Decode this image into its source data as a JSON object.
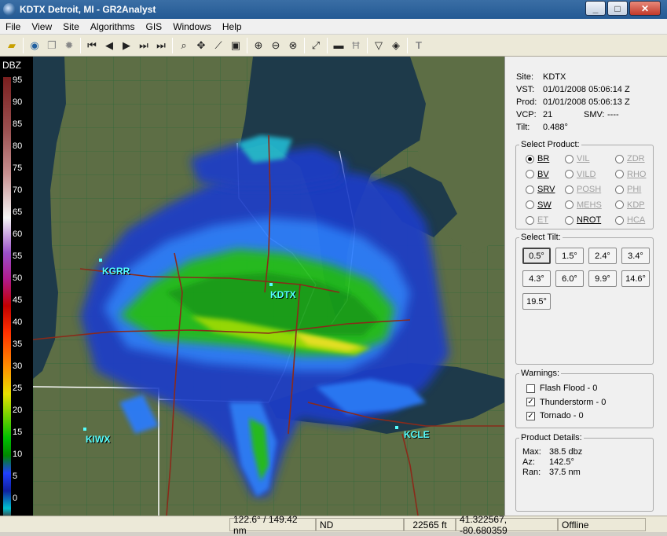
{
  "window": {
    "title": "KDTX Detroit, MI - GR2Analyst"
  },
  "menu": [
    "File",
    "View",
    "Site",
    "Algorithms",
    "GIS",
    "Windows",
    "Help"
  ],
  "scale": {
    "unit": "DBZ",
    "ticks": [
      "95",
      "90",
      "85",
      "80",
      "75",
      "70",
      "65",
      "60",
      "55",
      "50",
      "45",
      "40",
      "35",
      "30",
      "25",
      "20",
      "15",
      "10",
      "5",
      "0"
    ]
  },
  "map": {
    "site_labels": [
      "KGRR",
      "KDTX",
      "KIWX",
      "KCLE"
    ]
  },
  "info": {
    "site_label": "Site:",
    "site": "KDTX",
    "vst_label": "VST:",
    "vst": "01/01/2008  05:06:14 Z",
    "prod_label": "Prod:",
    "prod": "01/01/2008  05:06:13 Z",
    "vcp_label": "VCP:",
    "vcp": "21",
    "smv_label": "SMV:",
    "smv": "----",
    "tilt_label": "Tilt:",
    "tilt": "0.488°"
  },
  "products": {
    "legend": "Select Product:",
    "items": [
      {
        "label": "BR",
        "selected": true,
        "enabled": true
      },
      {
        "label": "VIL",
        "selected": false,
        "enabled": false
      },
      {
        "label": "ZDR",
        "selected": false,
        "enabled": false
      },
      {
        "label": "BV",
        "selected": false,
        "enabled": true
      },
      {
        "label": "VILD",
        "selected": false,
        "enabled": false
      },
      {
        "label": "RHO",
        "selected": false,
        "enabled": false
      },
      {
        "label": "SRV",
        "selected": false,
        "enabled": true
      },
      {
        "label": "POSH",
        "selected": false,
        "enabled": false
      },
      {
        "label": "PHI",
        "selected": false,
        "enabled": false
      },
      {
        "label": "SW",
        "selected": false,
        "enabled": true
      },
      {
        "label": "MEHS",
        "selected": false,
        "enabled": false
      },
      {
        "label": "KDP",
        "selected": false,
        "enabled": false
      },
      {
        "label": "ET",
        "selected": false,
        "enabled": false
      },
      {
        "label": "NROT",
        "selected": false,
        "enabled": true
      },
      {
        "label": "HCA",
        "selected": false,
        "enabled": false
      }
    ]
  },
  "tilts": {
    "legend": "Select Tilt:",
    "items": [
      "0.5°",
      "1.5°",
      "2.4°",
      "3.4°",
      "4.3°",
      "6.0°",
      "9.9°",
      "14.6°",
      "19.5°"
    ],
    "selected": "0.5°"
  },
  "warnings": {
    "legend": "Warnings:",
    "items": [
      {
        "label": "Flash Flood - 0",
        "checked": false
      },
      {
        "label": "Thunderstorm - 0",
        "checked": true
      },
      {
        "label": "Tornado - 0",
        "checked": true
      }
    ]
  },
  "details": {
    "legend": "Product Details:",
    "max_label": "Max:",
    "max": "38.5 dbz",
    "az_label": "Az:",
    "az": "142.5°",
    "ran_label": "Ran:",
    "ran": "37.5 nm"
  },
  "status": {
    "bearing": "122.6° / 149.42 nm",
    "value": "ND",
    "height": "22565 ft",
    "coords": "41.322567, -80.680359",
    "state": "Offline"
  },
  "colors": {
    "titlebar": "#245a94",
    "map_land": "#5d6e45",
    "map_water": "#1e3a4a",
    "highway": "#8a2a1a",
    "label": "#55ffff"
  }
}
